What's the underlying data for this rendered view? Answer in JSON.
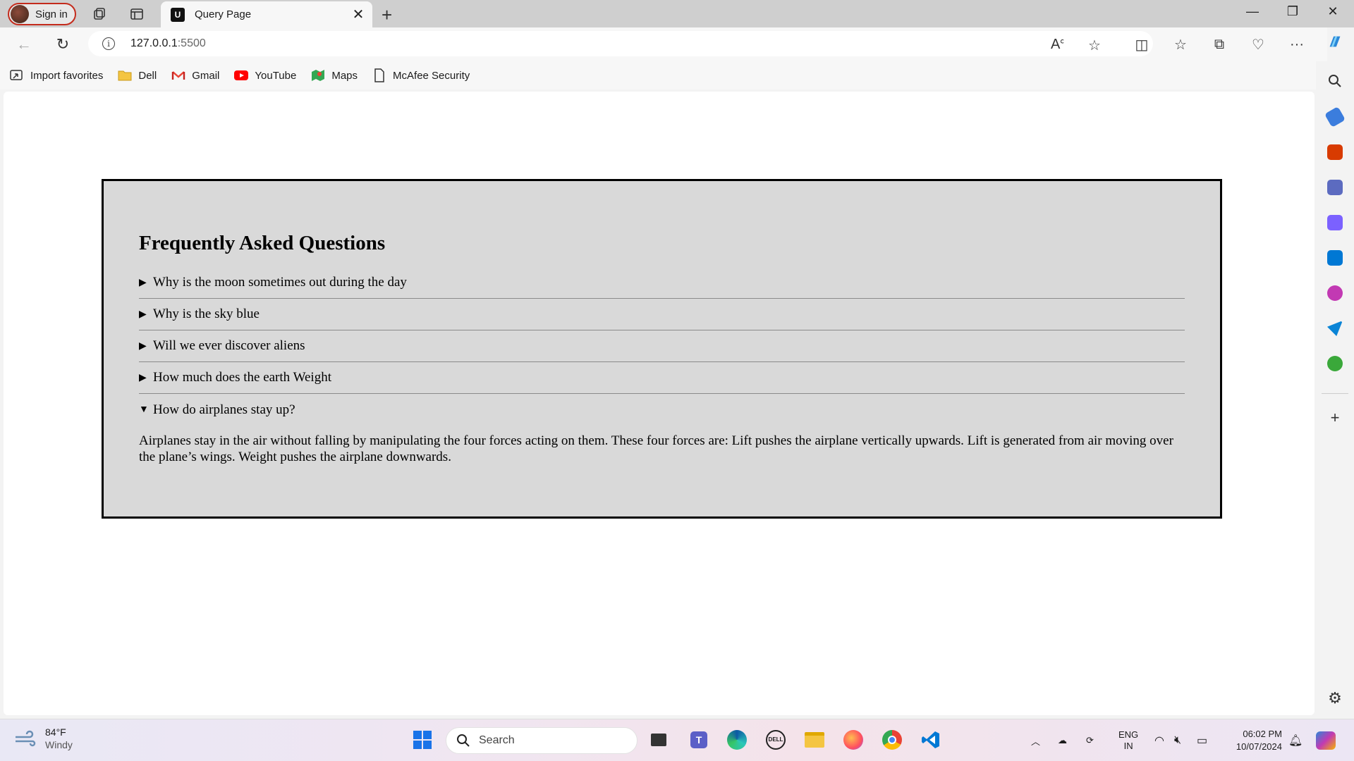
{
  "browser": {
    "signin_label": "Sign in",
    "tab_title": "Query Page",
    "tab_favicon": "U",
    "url_host": "127.0.0.1",
    "url_port": ":5500"
  },
  "bookmarks": [
    {
      "label": "Import favorites",
      "icon": "import-icon"
    },
    {
      "label": "Dell",
      "icon": "folder-icon"
    },
    {
      "label": "Gmail",
      "icon": "gmail-icon"
    },
    {
      "label": "YouTube",
      "icon": "youtube-icon"
    },
    {
      "label": "Maps",
      "icon": "maps-icon"
    },
    {
      "label": "McAfee Security",
      "icon": "page-icon"
    }
  ],
  "faq": {
    "title": "Frequently Asked Questions",
    "questions": [
      {
        "q": "Why is the moon sometimes out during the day",
        "open": false
      },
      {
        "q": "Why is the sky blue",
        "open": false
      },
      {
        "q": "Will we ever discover aliens",
        "open": false
      },
      {
        "q": "How much does the earth Weight",
        "open": false
      },
      {
        "q": "How do airplanes stay up?",
        "open": true
      }
    ],
    "answer": "Airplanes stay in the air without falling by manipulating the four forces acting on them. These four forces are: Lift pushes the airplane vertically upwards. Lift is generated from air moving over the plane’s wings. Weight pushes the airplane downwards."
  },
  "taskbar": {
    "weather_temp": "84°F",
    "weather_desc": "Windy",
    "search_placeholder": "Search",
    "lang_top": "ENG",
    "lang_bottom": "IN",
    "time": "06:02 PM",
    "date": "10/07/2024"
  },
  "colors": {
    "faq_bg": "#d9d9d9",
    "signin_border": "#c42b1c",
    "page_bg": "#ffffff"
  }
}
